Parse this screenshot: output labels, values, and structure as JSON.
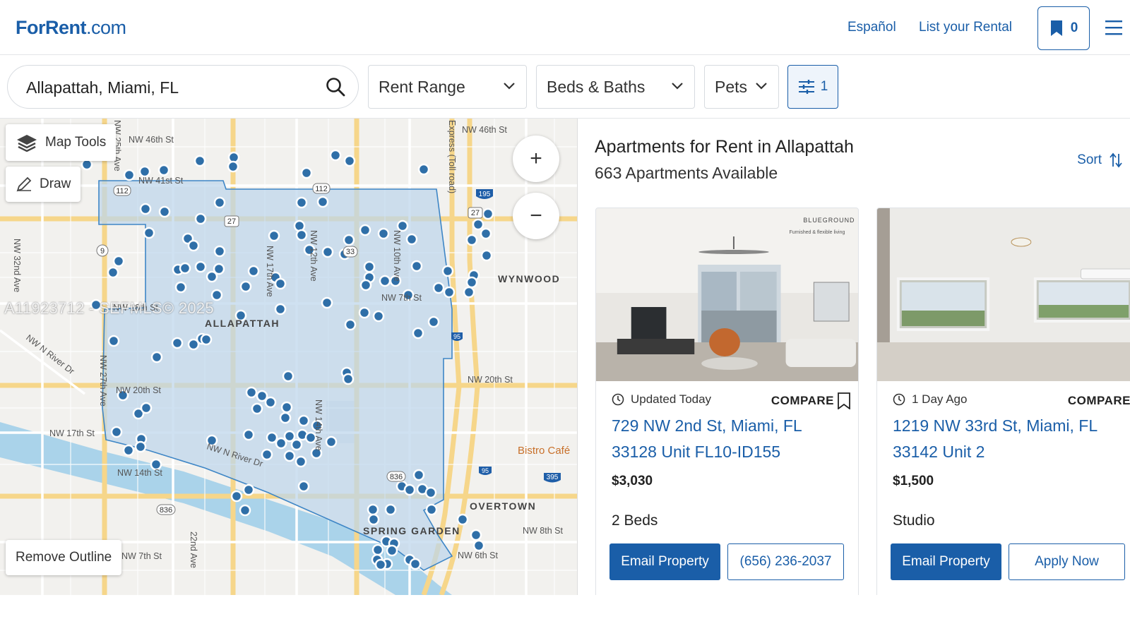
{
  "header": {
    "logo": "ForRent",
    "logo_suffix": ".com",
    "lang_link": "Español",
    "list_link": "List your Rental",
    "favorites_count": "0"
  },
  "filters": {
    "search_value": "Allapattah, Miami, FL",
    "rent_range": "Rent Range",
    "beds_baths": "Beds & Baths",
    "pets": "Pets",
    "more_count": "1"
  },
  "map": {
    "map_tools": "Map Tools",
    "draw": "Draw",
    "remove_outline": "Remove Outline",
    "zoom_in": "+",
    "zoom_out": "−",
    "watermark": "A11923712 - SEFMLS© 2025",
    "labels": {
      "allapattah": "ALLAPATTAH",
      "wynwood": "WYNWOOD",
      "overtown": "OVERTOWN",
      "spring_garden": "SPRING GARDEN",
      "nw46": "NW 46th St",
      "nw46b": "NW 46th St",
      "nw41": "NW 41st St",
      "nw28": "NW 28th St",
      "nw20": "NW 20th St",
      "nw20b": "NW 20th St",
      "nw17": "NW 17th St",
      "nw14": "NW 14th St",
      "nw8": "NW 8th St",
      "nw7": "NW 7th St",
      "nw6": "NW 6th St",
      "river": "NW N River Dr",
      "river2": "NW N River Dr",
      "bistro": "Bistro Café",
      "expressway": "Express (Toll road)",
      "nw17ave": "NW 17th Ave",
      "nw10ave": "NW 10th Ave",
      "nw12ave": "NW 12th Ave",
      "nw14ave": "NW 14th Ave",
      "nw27ave": "NW 27th Ave",
      "nw25ave": "NW 25th Ave",
      "nw32ave": "NW 32nd Ave",
      "nw22ave": "22nd Ave",
      "nw7st2": "NW 7th St"
    },
    "shields": [
      "112",
      "112",
      "27",
      "27",
      "9",
      "33",
      "195",
      "95",
      "95",
      "395",
      "836",
      "836"
    ]
  },
  "results": {
    "title": "Apartments for Rent in Allapattah",
    "count": "663 Apartments Available",
    "sort": "Sort"
  },
  "listings": [
    {
      "updated": "Updated Today",
      "compare": "COMPARE",
      "address": "729 NW 2nd St, Miami, FL 33128 Unit FL10-ID155",
      "price": "$3,030",
      "beds": "2 Beds",
      "primary_action": "Email Property",
      "secondary_action": "(656) 236-2037",
      "photo_brand": "BLUEGROUND",
      "photo_brand_sub": "Furnished & flexible living"
    },
    {
      "updated": "1 Day Ago",
      "compare": "COMPARE",
      "address": "1219 NW 33rd St, Miami, FL 33142 Unit 2",
      "price": "$1,500",
      "beds": "Studio",
      "primary_action": "Email Property",
      "secondary_action": "Apply Now"
    }
  ],
  "colors": {
    "brand": "#1a5ea8",
    "map_marker": "#2f6fa8",
    "outline_fill": "#bcd6ec"
  }
}
